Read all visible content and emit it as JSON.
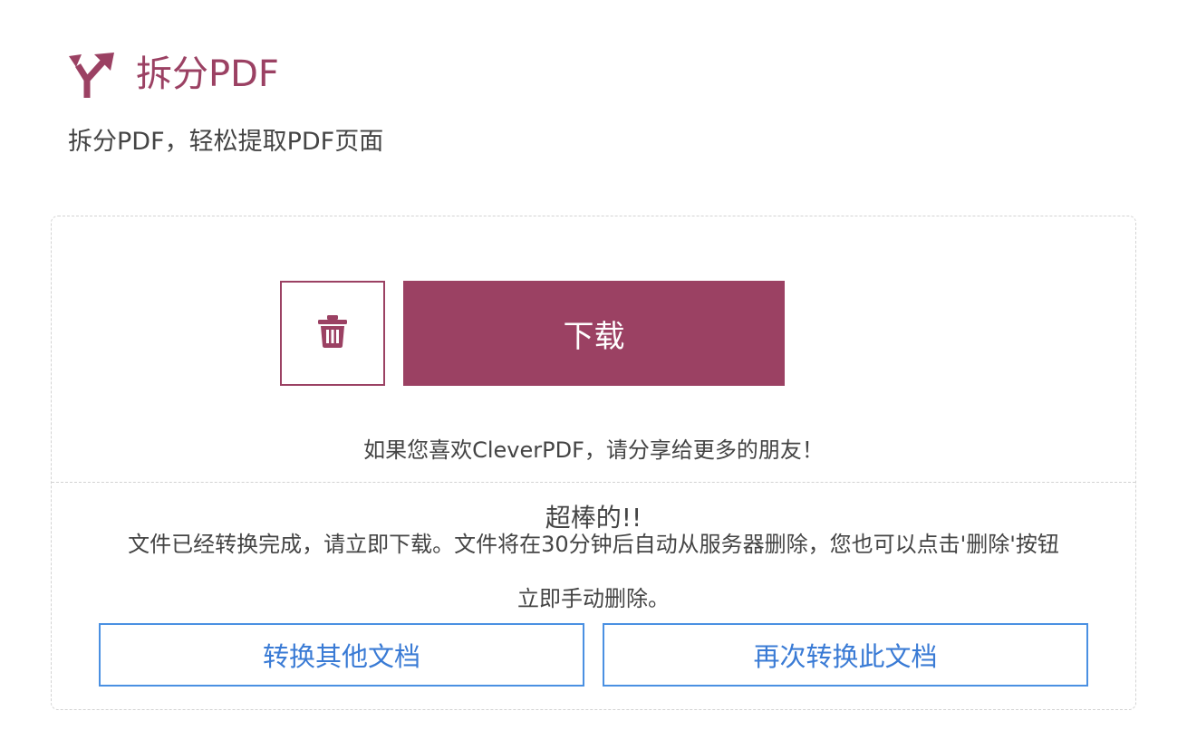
{
  "header": {
    "icon": "split-arrow-icon",
    "title": "拆分PDF",
    "subtitle": "拆分PDF，轻松提取PDF页面"
  },
  "result": {
    "delete_icon": "trash-icon",
    "download_label": "下载",
    "share_text": "如果您喜欢CleverPDF，请分享给更多的朋友！",
    "success_title": "超棒的!!",
    "success_message_line1": "文件已经转换完成，请立即下载。文件将在30分钟后自动从服务器删除，您也可以点击'删除'按钮",
    "success_message_line2": "立即手动删除。",
    "convert_other_label": "转换其他文档",
    "convert_again_label": "再次转换此文档"
  },
  "colors": {
    "brand": "#9b4163",
    "link_blue": "#4a90e2",
    "dashed_border": "#d3d3d3"
  }
}
